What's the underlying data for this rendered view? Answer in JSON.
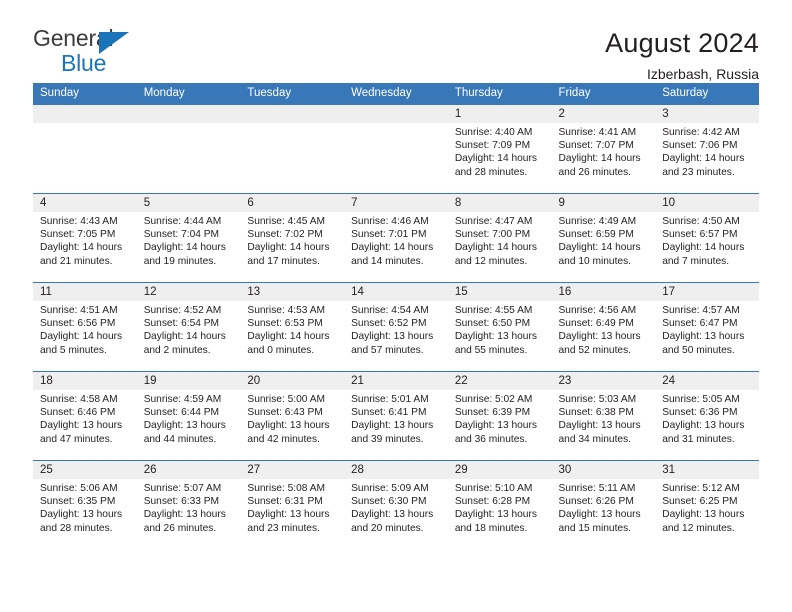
{
  "brand": {
    "word_one": "General",
    "word_two": "Blue",
    "triangle_icon": "triangle-icon",
    "accent_color": "#1b75bb",
    "text_color": "#3c3c3b"
  },
  "header": {
    "title": "August 2024",
    "subtitle": "Izberbash, Russia"
  },
  "theme": {
    "header_bg": "#3878b8",
    "daynum_bg": "#efefef",
    "grid_line": "#3878b8",
    "text": "#231f20"
  },
  "weekdays": [
    "Sunday",
    "Monday",
    "Tuesday",
    "Wednesday",
    "Thursday",
    "Friday",
    "Saturday"
  ],
  "labels": {
    "sunrise": "Sunrise:",
    "sunset": "Sunset:",
    "daylight": "Daylight:"
  },
  "weeks": [
    [
      {
        "day": "",
        "blank": true,
        "sunrise": "",
        "sunset": "",
        "daylight_line1": "",
        "daylight_line2": ""
      },
      {
        "day": "",
        "blank": true,
        "sunrise": "",
        "sunset": "",
        "daylight_line1": "",
        "daylight_line2": ""
      },
      {
        "day": "",
        "blank": true,
        "sunrise": "",
        "sunset": "",
        "daylight_line1": "",
        "daylight_line2": ""
      },
      {
        "day": "",
        "blank": true,
        "sunrise": "",
        "sunset": "",
        "daylight_line1": "",
        "daylight_line2": ""
      },
      {
        "day": "1",
        "sunrise": "Sunrise: 4:40 AM",
        "sunset": "Sunset: 7:09 PM",
        "daylight_line1": "Daylight: 14 hours",
        "daylight_line2": "and 28 minutes."
      },
      {
        "day": "2",
        "sunrise": "Sunrise: 4:41 AM",
        "sunset": "Sunset: 7:07 PM",
        "daylight_line1": "Daylight: 14 hours",
        "daylight_line2": "and 26 minutes."
      },
      {
        "day": "3",
        "sunrise": "Sunrise: 4:42 AM",
        "sunset": "Sunset: 7:06 PM",
        "daylight_line1": "Daylight: 14 hours",
        "daylight_line2": "and 23 minutes."
      }
    ],
    [
      {
        "day": "4",
        "sunrise": "Sunrise: 4:43 AM",
        "sunset": "Sunset: 7:05 PM",
        "daylight_line1": "Daylight: 14 hours",
        "daylight_line2": "and 21 minutes."
      },
      {
        "day": "5",
        "sunrise": "Sunrise: 4:44 AM",
        "sunset": "Sunset: 7:04 PM",
        "daylight_line1": "Daylight: 14 hours",
        "daylight_line2": "and 19 minutes."
      },
      {
        "day": "6",
        "sunrise": "Sunrise: 4:45 AM",
        "sunset": "Sunset: 7:02 PM",
        "daylight_line1": "Daylight: 14 hours",
        "daylight_line2": "and 17 minutes."
      },
      {
        "day": "7",
        "sunrise": "Sunrise: 4:46 AM",
        "sunset": "Sunset: 7:01 PM",
        "daylight_line1": "Daylight: 14 hours",
        "daylight_line2": "and 14 minutes."
      },
      {
        "day": "8",
        "sunrise": "Sunrise: 4:47 AM",
        "sunset": "Sunset: 7:00 PM",
        "daylight_line1": "Daylight: 14 hours",
        "daylight_line2": "and 12 minutes."
      },
      {
        "day": "9",
        "sunrise": "Sunrise: 4:49 AM",
        "sunset": "Sunset: 6:59 PM",
        "daylight_line1": "Daylight: 14 hours",
        "daylight_line2": "and 10 minutes."
      },
      {
        "day": "10",
        "sunrise": "Sunrise: 4:50 AM",
        "sunset": "Sunset: 6:57 PM",
        "daylight_line1": "Daylight: 14 hours",
        "daylight_line2": "and 7 minutes."
      }
    ],
    [
      {
        "day": "11",
        "sunrise": "Sunrise: 4:51 AM",
        "sunset": "Sunset: 6:56 PM",
        "daylight_line1": "Daylight: 14 hours",
        "daylight_line2": "and 5 minutes."
      },
      {
        "day": "12",
        "sunrise": "Sunrise: 4:52 AM",
        "sunset": "Sunset: 6:54 PM",
        "daylight_line1": "Daylight: 14 hours",
        "daylight_line2": "and 2 minutes."
      },
      {
        "day": "13",
        "sunrise": "Sunrise: 4:53 AM",
        "sunset": "Sunset: 6:53 PM",
        "daylight_line1": "Daylight: 14 hours",
        "daylight_line2": "and 0 minutes."
      },
      {
        "day": "14",
        "sunrise": "Sunrise: 4:54 AM",
        "sunset": "Sunset: 6:52 PM",
        "daylight_line1": "Daylight: 13 hours",
        "daylight_line2": "and 57 minutes."
      },
      {
        "day": "15",
        "sunrise": "Sunrise: 4:55 AM",
        "sunset": "Sunset: 6:50 PM",
        "daylight_line1": "Daylight: 13 hours",
        "daylight_line2": "and 55 minutes."
      },
      {
        "day": "16",
        "sunrise": "Sunrise: 4:56 AM",
        "sunset": "Sunset: 6:49 PM",
        "daylight_line1": "Daylight: 13 hours",
        "daylight_line2": "and 52 minutes."
      },
      {
        "day": "17",
        "sunrise": "Sunrise: 4:57 AM",
        "sunset": "Sunset: 6:47 PM",
        "daylight_line1": "Daylight: 13 hours",
        "daylight_line2": "and 50 minutes."
      }
    ],
    [
      {
        "day": "18",
        "sunrise": "Sunrise: 4:58 AM",
        "sunset": "Sunset: 6:46 PM",
        "daylight_line1": "Daylight: 13 hours",
        "daylight_line2": "and 47 minutes."
      },
      {
        "day": "19",
        "sunrise": "Sunrise: 4:59 AM",
        "sunset": "Sunset: 6:44 PM",
        "daylight_line1": "Daylight: 13 hours",
        "daylight_line2": "and 44 minutes."
      },
      {
        "day": "20",
        "sunrise": "Sunrise: 5:00 AM",
        "sunset": "Sunset: 6:43 PM",
        "daylight_line1": "Daylight: 13 hours",
        "daylight_line2": "and 42 minutes."
      },
      {
        "day": "21",
        "sunrise": "Sunrise: 5:01 AM",
        "sunset": "Sunset: 6:41 PM",
        "daylight_line1": "Daylight: 13 hours",
        "daylight_line2": "and 39 minutes."
      },
      {
        "day": "22",
        "sunrise": "Sunrise: 5:02 AM",
        "sunset": "Sunset: 6:39 PM",
        "daylight_line1": "Daylight: 13 hours",
        "daylight_line2": "and 36 minutes."
      },
      {
        "day": "23",
        "sunrise": "Sunrise: 5:03 AM",
        "sunset": "Sunset: 6:38 PM",
        "daylight_line1": "Daylight: 13 hours",
        "daylight_line2": "and 34 minutes."
      },
      {
        "day": "24",
        "sunrise": "Sunrise: 5:05 AM",
        "sunset": "Sunset: 6:36 PM",
        "daylight_line1": "Daylight: 13 hours",
        "daylight_line2": "and 31 minutes."
      }
    ],
    [
      {
        "day": "25",
        "sunrise": "Sunrise: 5:06 AM",
        "sunset": "Sunset: 6:35 PM",
        "daylight_line1": "Daylight: 13 hours",
        "daylight_line2": "and 28 minutes."
      },
      {
        "day": "26",
        "sunrise": "Sunrise: 5:07 AM",
        "sunset": "Sunset: 6:33 PM",
        "daylight_line1": "Daylight: 13 hours",
        "daylight_line2": "and 26 minutes."
      },
      {
        "day": "27",
        "sunrise": "Sunrise: 5:08 AM",
        "sunset": "Sunset: 6:31 PM",
        "daylight_line1": "Daylight: 13 hours",
        "daylight_line2": "and 23 minutes."
      },
      {
        "day": "28",
        "sunrise": "Sunrise: 5:09 AM",
        "sunset": "Sunset: 6:30 PM",
        "daylight_line1": "Daylight: 13 hours",
        "daylight_line2": "and 20 minutes."
      },
      {
        "day": "29",
        "sunrise": "Sunrise: 5:10 AM",
        "sunset": "Sunset: 6:28 PM",
        "daylight_line1": "Daylight: 13 hours",
        "daylight_line2": "and 18 minutes."
      },
      {
        "day": "30",
        "sunrise": "Sunrise: 5:11 AM",
        "sunset": "Sunset: 6:26 PM",
        "daylight_line1": "Daylight: 13 hours",
        "daylight_line2": "and 15 minutes."
      },
      {
        "day": "31",
        "sunrise": "Sunrise: 5:12 AM",
        "sunset": "Sunset: 6:25 PM",
        "daylight_line1": "Daylight: 13 hours",
        "daylight_line2": "and 12 minutes."
      }
    ]
  ]
}
